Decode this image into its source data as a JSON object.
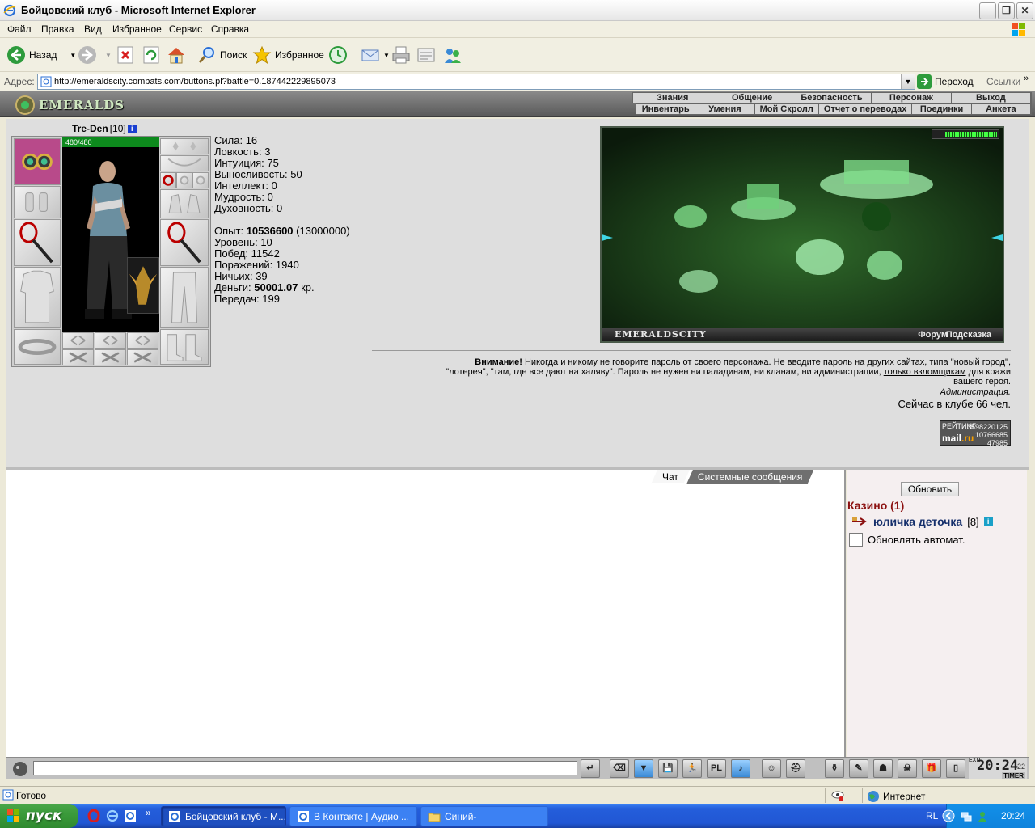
{
  "window": {
    "title": "Бойцовский клуб - Microsoft Internet Explorer",
    "minimize": "_",
    "maximize": "❐",
    "close": "✕"
  },
  "menu": [
    "Файл",
    "Правка",
    "Вид",
    "Избранное",
    "Сервис",
    "Справка"
  ],
  "toolbar": {
    "back": "Назад",
    "search": "Поиск",
    "favorites": "Избранное"
  },
  "address": {
    "label": "Адрес:",
    "url": "http://emeraldscity.combats.com/buttons.pl?battle=0.187442229895073",
    "go": "Переход",
    "links": "Ссылки"
  },
  "game": {
    "logo": "EMERALDS",
    "nav_top": [
      "Знания",
      "Общение",
      "Безопасность",
      "Персонаж",
      "Выход"
    ],
    "nav_bottom": [
      "Инвентарь",
      "Умения",
      "Мой Скролл",
      "Отчет о переводах",
      "Поединки",
      "Анкета"
    ]
  },
  "character": {
    "name": "Tre-Den",
    "level": "[10]",
    "hp": "480/480",
    "hp_fraction": 1.0,
    "stats": [
      {
        "label": "Сила:",
        "value": "16"
      },
      {
        "label": "Ловкость:",
        "value": "3"
      },
      {
        "label": "Интуиция:",
        "value": "75"
      },
      {
        "label": "Выносливость:",
        "value": "50"
      },
      {
        "label": "Интеллект:",
        "value": "0"
      },
      {
        "label": "Мудрость:",
        "value": "0"
      },
      {
        "label": "Духовность:",
        "value": "0"
      }
    ],
    "exp_label": "Опыт:",
    "exp_value": "10536600",
    "exp_next": "(13000000)",
    "level_label": "Уровень:",
    "level_value": "10",
    "wins_label": "Побед:",
    "wins_value": "11542",
    "losses_label": "Поражений:",
    "losses_value": "1940",
    "draws_label": "Ничьих:",
    "draws_value": "39",
    "money_label": "Деньги:",
    "money_value": "50001.07",
    "money_unit": "кр.",
    "transfers_label": "Передач:",
    "transfers_value": "199"
  },
  "scene": {
    "city": "EMERALDSCITY",
    "forum": "Форум",
    "hint": "Подсказка"
  },
  "notice": {
    "bold": "Внимание!",
    "line1": " Никогда и никому не говорите пароль от своего персонажа. Не вводите пароль на других сайтах, типа \"новый город\",",
    "line2a": "\"лотерея\", \"там, где все дают на халяву\". Пароль не нужен ни паладинам, ни кланам, ни администрации, ",
    "link": "только взломщикам",
    "line2b": " для кражи",
    "line3": "вашего героя.",
    "admin": "Администрация.",
    "online": "Сейчас в клубе 66 чел."
  },
  "counter": {
    "label": "РЕЙТИНГ",
    "n1": "3598220125",
    "n2": "10766685",
    "n3": "47985",
    "mail": "mail",
    "ru": ".ru"
  },
  "chat": {
    "tab_chat": "Чат",
    "tab_system": "Системные сообщения"
  },
  "side": {
    "refresh": "Обновить",
    "room": "Казино (1)",
    "user_nick": "юличка деточка",
    "user_level": "[8]",
    "auto_update": "Обновлять автомат."
  },
  "clock": {
    "time": "20:24",
    "seconds": "22",
    "timer": "TIMER",
    "exit": "EXIT"
  },
  "status": {
    "text": "Готово",
    "zone": "Интернет"
  },
  "taskbar": {
    "start": "пуск",
    "tasks": [
      "Бойцовский клуб - М...",
      "В Контакте | Аудио ...",
      "Синий-"
    ],
    "lang": "RL",
    "time": "20:24"
  }
}
